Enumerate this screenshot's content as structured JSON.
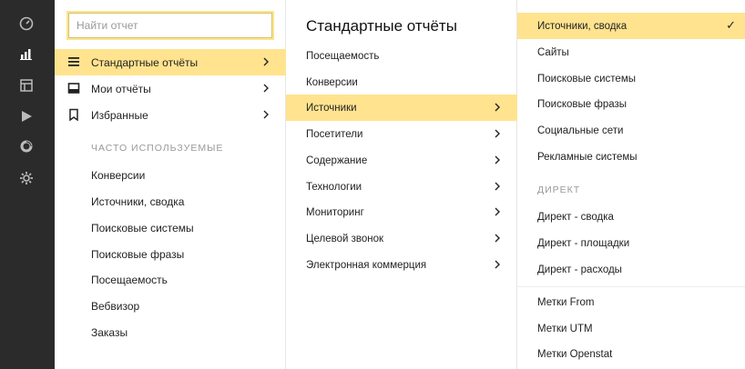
{
  "colors": {
    "rail_bg": "#2b2b2b",
    "active_bg": "#ffe38f",
    "search_glow": "#fbe58a"
  },
  "rail": {
    "icons": [
      "dashboard-icon",
      "reports-icon",
      "layout-icon",
      "play-icon",
      "segments-icon",
      "settings-icon"
    ]
  },
  "search": {
    "placeholder": "Найти отчет",
    "value": ""
  },
  "main_menu": {
    "items": [
      {
        "label": "Стандартные отчёты",
        "icon": "list-icon",
        "active": true
      },
      {
        "label": "Мои отчёты",
        "icon": "tray-icon",
        "active": false
      },
      {
        "label": "Избранные",
        "icon": "bookmark-icon",
        "active": false
      }
    ]
  },
  "frequent": {
    "title": "Часто используемые",
    "items": [
      "Конверсии",
      "Источники, сводка",
      "Поисковые системы",
      "Поисковые фразы",
      "Посещаемость",
      "Вебвизор",
      "Заказы"
    ]
  },
  "standard": {
    "title": "Стандартные отчёты",
    "items": [
      {
        "label": "Посещаемость",
        "has_children": false,
        "active": false
      },
      {
        "label": "Конверсии",
        "has_children": false,
        "active": false
      },
      {
        "label": "Источники",
        "has_children": true,
        "active": true
      },
      {
        "label": "Посетители",
        "has_children": true,
        "active": false
      },
      {
        "label": "Содержание",
        "has_children": true,
        "active": false
      },
      {
        "label": "Технологии",
        "has_children": true,
        "active": false
      },
      {
        "label": "Мониторинг",
        "has_children": true,
        "active": false
      },
      {
        "label": "Целевой звонок",
        "has_children": true,
        "active": false
      },
      {
        "label": "Электронная коммерция",
        "has_children": true,
        "active": false
      }
    ]
  },
  "sources": {
    "items": [
      {
        "label": "Источники, сводка",
        "active": true,
        "checked": true
      },
      {
        "label": "Сайты"
      },
      {
        "label": "Поисковые системы"
      },
      {
        "label": "Поисковые фразы"
      },
      {
        "label": "Социальные сети"
      },
      {
        "label": "Рекламные системы"
      }
    ],
    "direct_title": "Директ",
    "direct_items": [
      "Директ - сводка",
      "Директ - площадки",
      "Директ - расходы"
    ],
    "tag_items": [
      "Метки From",
      "Метки UTM",
      "Метки Openstat"
    ],
    "check_glyph": "✓"
  }
}
